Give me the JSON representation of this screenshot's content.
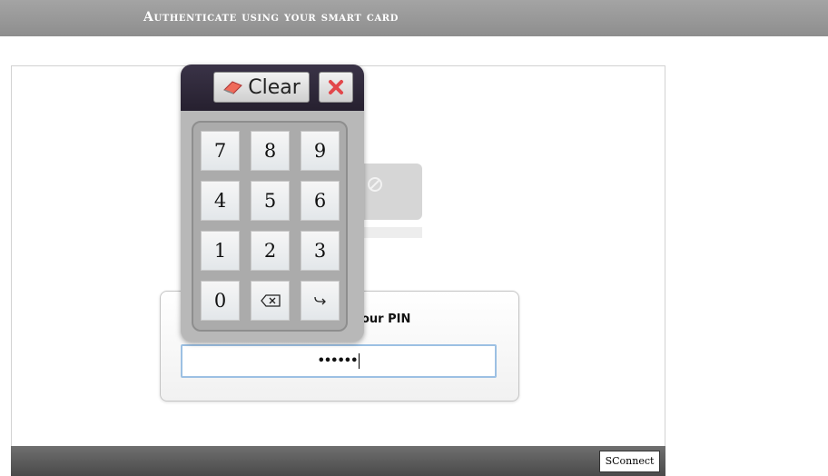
{
  "header": {
    "title": "Authenticate using your smart card"
  },
  "pin_prompt": {
    "label_visible": "our PIN",
    "masked_value": "••••••"
  },
  "footer": {
    "logo_text": "SConnect"
  },
  "keypad": {
    "clear_label": "Clear",
    "keys": [
      {
        "label": "7",
        "kind": "digit"
      },
      {
        "label": "8",
        "kind": "digit"
      },
      {
        "label": "9",
        "kind": "digit"
      },
      {
        "label": "4",
        "kind": "digit"
      },
      {
        "label": "5",
        "kind": "digit"
      },
      {
        "label": "6",
        "kind": "digit"
      },
      {
        "label": "1",
        "kind": "digit"
      },
      {
        "label": "2",
        "kind": "digit"
      },
      {
        "label": "3",
        "kind": "digit"
      },
      {
        "label": "0",
        "kind": "digit"
      },
      {
        "label": "",
        "kind": "backspace",
        "icon": "backspace-icon"
      },
      {
        "label": "",
        "kind": "enter",
        "icon": "enter-arrow-icon"
      }
    ]
  },
  "colors": {
    "header_bg": "#999999",
    "keypad_top": "#2e2839",
    "close_icon": "#e2474b",
    "input_border": "#9cc0e3"
  }
}
